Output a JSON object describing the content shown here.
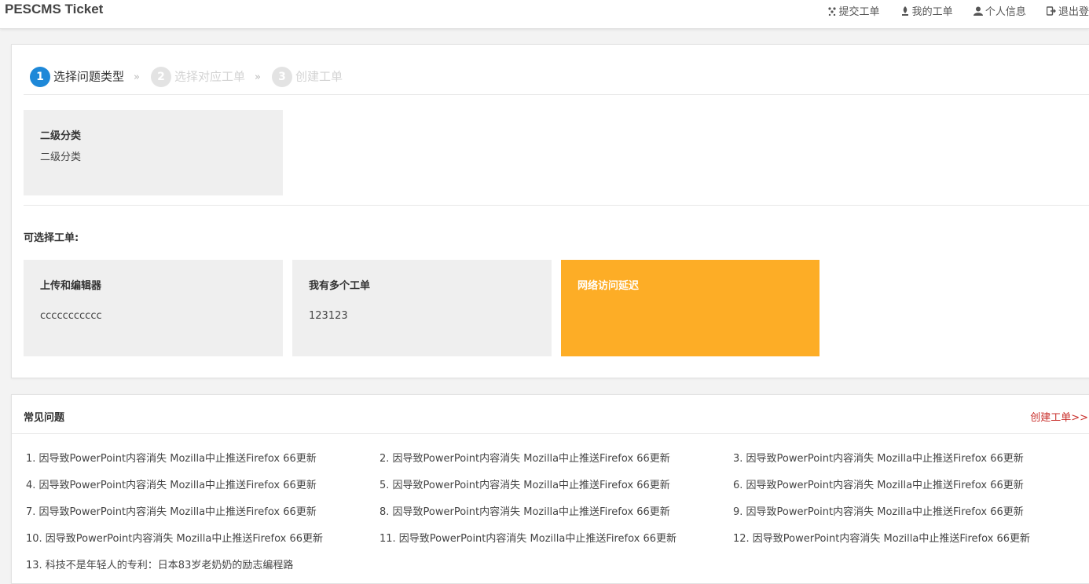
{
  "header": {
    "brand": "PESCMS Ticket",
    "nav": [
      {
        "label": "提交工单",
        "icon": "submit-icon"
      },
      {
        "label": "我的工单",
        "icon": "tickets-icon"
      },
      {
        "label": "个人信息",
        "icon": "user-icon"
      },
      {
        "label": "退出登",
        "icon": "logout-icon"
      }
    ]
  },
  "steps": [
    {
      "num": "1",
      "label": "选择问题类型",
      "state": "active"
    },
    {
      "num": "2",
      "label": "选择对应工单",
      "state": "inactive"
    },
    {
      "num": "3",
      "label": "创建工单",
      "state": "inactive"
    }
  ],
  "step_separator": "»",
  "category": {
    "title": "二级分类",
    "desc": "二级分类"
  },
  "selectable_label": "可选择工单:",
  "tickets": [
    {
      "title": "上传和编辑器",
      "desc": "ccccccccccc"
    },
    {
      "title": "我有多个工单",
      "desc": "123123"
    },
    {
      "title": "网络访问延迟",
      "desc": ""
    }
  ],
  "faq": {
    "title": "常见问题",
    "create_link": "创建工单>>",
    "items": [
      "1. 因导致PowerPoint内容消失 Mozilla中止推送Firefox 66更新",
      "2. 因导致PowerPoint内容消失 Mozilla中止推送Firefox 66更新",
      "3. 因导致PowerPoint内容消失 Mozilla中止推送Firefox 66更新",
      "4. 因导致PowerPoint内容消失 Mozilla中止推送Firefox 66更新",
      "5. 因导致PowerPoint内容消失 Mozilla中止推送Firefox 66更新",
      "6. 因导致PowerPoint内容消失 Mozilla中止推送Firefox 66更新",
      "7. 因导致PowerPoint内容消失 Mozilla中止推送Firefox 66更新",
      "8. 因导致PowerPoint内容消失 Mozilla中止推送Firefox 66更新",
      "9. 因导致PowerPoint内容消失 Mozilla中止推送Firefox 66更新",
      "10. 因导致PowerPoint内容消失 Mozilla中止推送Firefox 66更新",
      "11. 因导致PowerPoint内容消失 Mozilla中止推送Firefox 66更新",
      "12. 因导致PowerPoint内容消失 Mozilla中止推送Firefox 66更新",
      "13. 科技不是年轻人的专利：日本83岁老奶奶的励志编程路"
    ]
  }
}
